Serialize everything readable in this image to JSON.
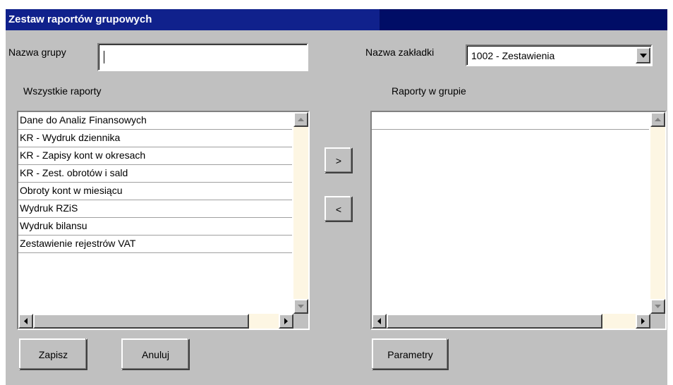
{
  "window": {
    "title": "Zestaw raportów grupowych"
  },
  "group_name": {
    "label": "Nazwa grupy",
    "value": ""
  },
  "tab_name": {
    "label": "Nazwa zakładki",
    "selected": "1002 - Zestawienia"
  },
  "all_reports": {
    "label": "Wszystkie raporty",
    "items": [
      "Dane do Analiz Finansowych",
      "KR - Wydruk dziennika",
      "KR - Zapisy kont w okresach",
      "KR - Zest. obrotów i sald",
      "Obroty kont w miesiącu",
      "Wydruk RZiS",
      "Wydruk bilansu",
      "Zestawienie rejestrów VAT"
    ]
  },
  "group_reports": {
    "label": "Raporty w grupie",
    "items": [
      ""
    ]
  },
  "buttons": {
    "add": ">",
    "remove": "<",
    "save": "Zapisz",
    "cancel": "Anuluj",
    "parameters": "Parametry"
  },
  "colors": {
    "titlebar": "#10218c",
    "face": "#c0c0c0",
    "scroll_track": "#fdf6e3"
  }
}
